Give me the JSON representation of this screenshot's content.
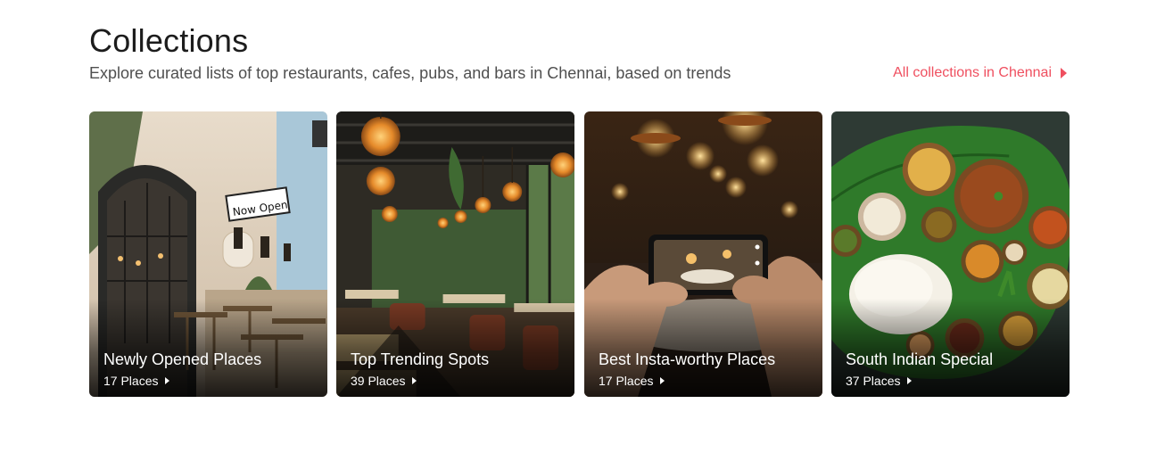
{
  "header": {
    "title": "Collections",
    "subtitle": "Explore curated lists of top restaurants, cafes, pubs, and bars in Chennai, based on trends",
    "all_link": "All collections in Chennai"
  },
  "collections": [
    {
      "name": "Newly Opened Places",
      "count": "17 Places",
      "sign_text": "Now Open"
    },
    {
      "name": "Top Trending Spots",
      "count": "39 Places"
    },
    {
      "name": "Best Insta-worthy Places",
      "count": "17 Places"
    },
    {
      "name": "South Indian Special",
      "count": "37 Places"
    }
  ],
  "colors": {
    "accent": "#ef4f5f",
    "title": "#1c1c1c",
    "subtitle": "#4f4f4f"
  }
}
